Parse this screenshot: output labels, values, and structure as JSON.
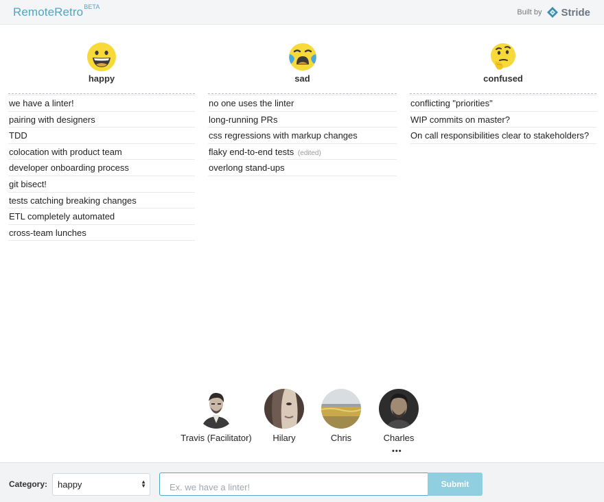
{
  "header": {
    "brand": "RemoteRetro",
    "brand_badge": "BETA",
    "built_by": "Built by",
    "partner": "Stride"
  },
  "columns": [
    {
      "title": "happy",
      "icon": "grinning-face-icon",
      "ideas": [
        "we have a linter!",
        "pairing with designers",
        "TDD",
        "colocation with product team",
        "developer onboarding process",
        "git bisect!",
        "tests catching breaking changes",
        "ETL completely automated",
        "cross-team lunches"
      ]
    },
    {
      "title": "sad",
      "icon": "crying-face-icon",
      "ideas": [
        "no one uses the linter",
        "long-running PRs",
        "css regressions with markup changes",
        "flaky end-to-end tests",
        "overlong stand-ups"
      ],
      "edited_marker": "(edited)"
    },
    {
      "title": "confused",
      "icon": "thinking-face-icon",
      "ideas": [
        "conflicting \"priorities\"",
        "WIP commits on master?",
        "On call responsibilities clear to stakeholders?"
      ]
    }
  ],
  "participants": [
    {
      "name": "Travis (Facilitator)",
      "avatar": "avatar-travis"
    },
    {
      "name": "Hilary",
      "avatar": "avatar-hilary"
    },
    {
      "name": "Chris",
      "avatar": "avatar-chris"
    },
    {
      "name": "Charles",
      "avatar": "avatar-charles"
    }
  ],
  "typing_indicator": "•••",
  "footer": {
    "category_label": "Category:",
    "category_selected": "happy",
    "input_placeholder": "Ex. we have a linter!",
    "input_value": "",
    "submit_label": "Submit"
  },
  "colors": {
    "brand": "#4aa8c9",
    "submit_bg": "#8fcfdf",
    "emoji": "#f7d93a"
  }
}
